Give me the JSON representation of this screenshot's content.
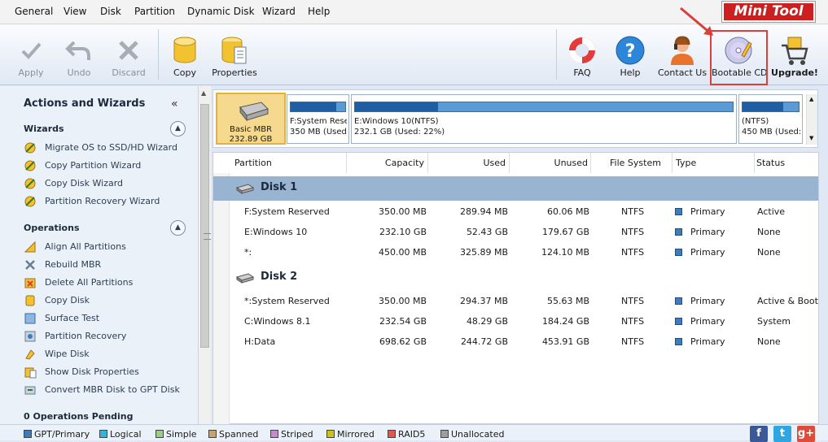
{
  "menu": [
    "General",
    "View",
    "Disk",
    "Partition",
    "Dynamic Disk",
    "Wizard",
    "Help"
  ],
  "logo": {
    "part1": "Mini",
    "part2": "Tool"
  },
  "toolbar": {
    "apply": "Apply",
    "undo": "Undo",
    "discard": "Discard",
    "copy": "Copy",
    "properties": "Properties",
    "faq": "FAQ",
    "help": "Help",
    "contact": "Contact Us",
    "bootable": "Bootable CD",
    "upgrade": "Upgrade!"
  },
  "sidebar": {
    "title": "Actions and Wizards",
    "collapse": "«",
    "wizards_heading": "Wizards",
    "wizards": [
      "Migrate OS to SSD/HD Wizard",
      "Copy Partition Wizard",
      "Copy Disk Wizard",
      "Partition Recovery Wizard"
    ],
    "operations_heading": "Operations",
    "operations": [
      "Align All Partitions",
      "Rebuild MBR",
      "Delete All Partitions",
      "Copy Disk",
      "Surface Test",
      "Partition Recovery",
      "Wipe Disk",
      "Show Disk Properties",
      "Convert MBR Disk to GPT Disk"
    ],
    "pending": "0 Operations Pending"
  },
  "diskmap": {
    "basic_label": "Basic MBR",
    "basic_size": "232.89 GB",
    "parts": [
      {
        "name": "F:System Rese",
        "detail": "350 MB (Used:",
        "used_fraction": 0.83
      },
      {
        "name": "E:Windows 10(NTFS)",
        "detail": "232.1 GB (Used: 22%)",
        "used_fraction": 0.22
      },
      {
        "name": "(NTFS)",
        "detail": "450 MB (Used:",
        "used_fraction": 0.72
      }
    ]
  },
  "table": {
    "headers": [
      "Partition",
      "Capacity",
      "Used",
      "Unused",
      "File System",
      "Type",
      "Status"
    ],
    "disk1": "Disk 1",
    "disk2": "Disk 2",
    "rows1": [
      {
        "partition": "F:System Reserved",
        "capacity": "350.00 MB",
        "used": "289.94 MB",
        "unused": "60.06 MB",
        "fs": "NTFS",
        "type": "Primary",
        "status": "Active"
      },
      {
        "partition": "E:Windows 10",
        "capacity": "232.10 GB",
        "used": "52.43 GB",
        "unused": "179.67 GB",
        "fs": "NTFS",
        "type": "Primary",
        "status": "None"
      },
      {
        "partition": "*:",
        "capacity": "450.00 MB",
        "used": "325.89 MB",
        "unused": "124.10 MB",
        "fs": "NTFS",
        "type": "Primary",
        "status": "None"
      }
    ],
    "rows2": [
      {
        "partition": "*:System Reserved",
        "capacity": "350.00 MB",
        "used": "294.37 MB",
        "unused": "55.63 MB",
        "fs": "NTFS",
        "type": "Primary",
        "status": "Active & Boot"
      },
      {
        "partition": "C:Windows 8.1",
        "capacity": "232.54 GB",
        "used": "48.29 GB",
        "unused": "184.24 GB",
        "fs": "NTFS",
        "type": "Primary",
        "status": "System"
      },
      {
        "partition": "H:Data",
        "capacity": "698.62 GB",
        "used": "244.72 GB",
        "unused": "453.91 GB",
        "fs": "NTFS",
        "type": "Primary",
        "status": "None"
      }
    ]
  },
  "legend": [
    {
      "label": "GPT/Primary",
      "color": "#3b7bbf"
    },
    {
      "label": "Logical",
      "color": "#34b4d9"
    },
    {
      "label": "Simple",
      "color": "#9ccc8a"
    },
    {
      "label": "Spanned",
      "color": "#c9a36b"
    },
    {
      "label": "Striped",
      "color": "#c98ac9"
    },
    {
      "label": "Mirrored",
      "color": "#c9c21f"
    },
    {
      "label": "RAID5",
      "color": "#e2574c"
    },
    {
      "label": "Unallocated",
      "color": "#9e9e9e"
    }
  ],
  "social": [
    {
      "name": "facebook",
      "glyph": "f",
      "color": "#3b5998"
    },
    {
      "name": "twitter",
      "glyph": "t",
      "color": "#2fa6df"
    },
    {
      "name": "googleplus",
      "glyph": "g+",
      "color": "#dd4b39"
    }
  ]
}
